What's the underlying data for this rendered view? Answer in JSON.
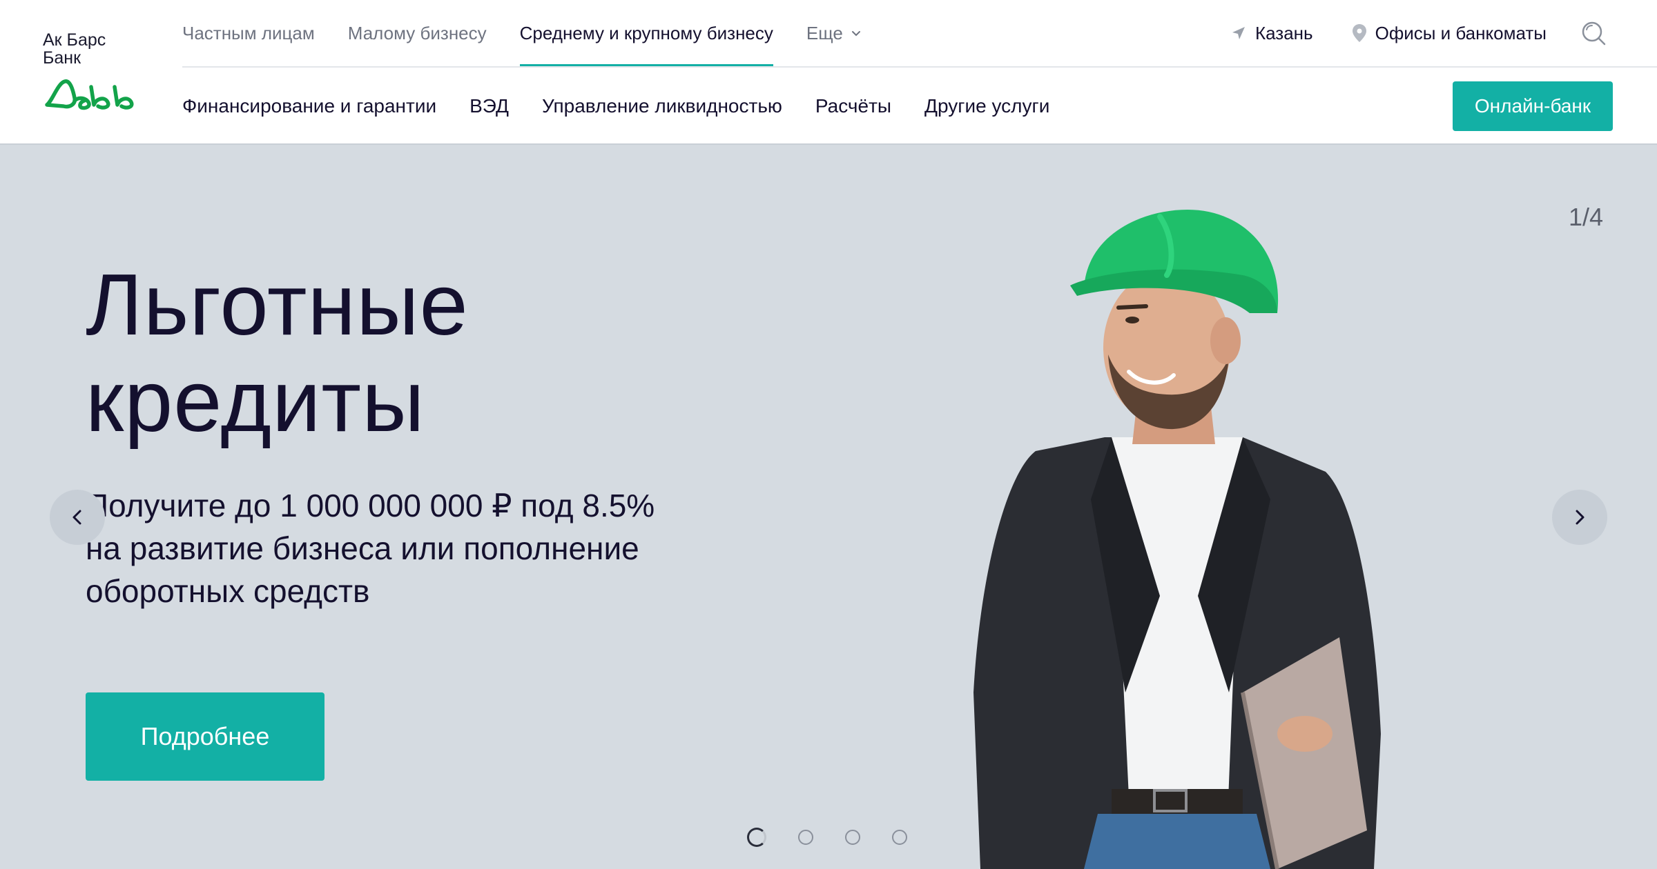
{
  "logo": {
    "line1": "Ак Барс",
    "line2": "Банк"
  },
  "top_nav": [
    {
      "label": "Частным лицам",
      "active": false
    },
    {
      "label": "Малому бизнесу",
      "active": false
    },
    {
      "label": "Среднему и крупному бизнесу",
      "active": true
    },
    {
      "label": "Еще",
      "active": false,
      "has_dropdown": true
    }
  ],
  "utility": {
    "city": "Казань",
    "offices": "Офисы и банкоматы",
    "icons": [
      "location-arrow-icon",
      "map-pin-icon",
      "search-icon"
    ]
  },
  "sub_nav": [
    "Финансирование и гарантии",
    "ВЭД",
    "Управление ликвидностью",
    "Расчёты",
    "Другие услуги"
  ],
  "online_bank_label": "Онлайн-банк",
  "hero": {
    "counter": "1/4",
    "title_line1": "Льготные",
    "title_line2": "кредиты",
    "subtitle_line1": "Получите до 1 000 000 000 ₽ под 8.5%",
    "subtitle_line2": "на развитие бизнеса или пополнение",
    "subtitle_line3": "оборотных средств",
    "cta_label": "Подробнее",
    "slides_total": 4,
    "active_slide": 1
  },
  "colors": {
    "accent": "#13b0a5",
    "brand_green": "#13a34a",
    "text_dark": "#14102e",
    "hero_bg": "#d5dbe1",
    "helmet_green": "#1fbf6a"
  }
}
